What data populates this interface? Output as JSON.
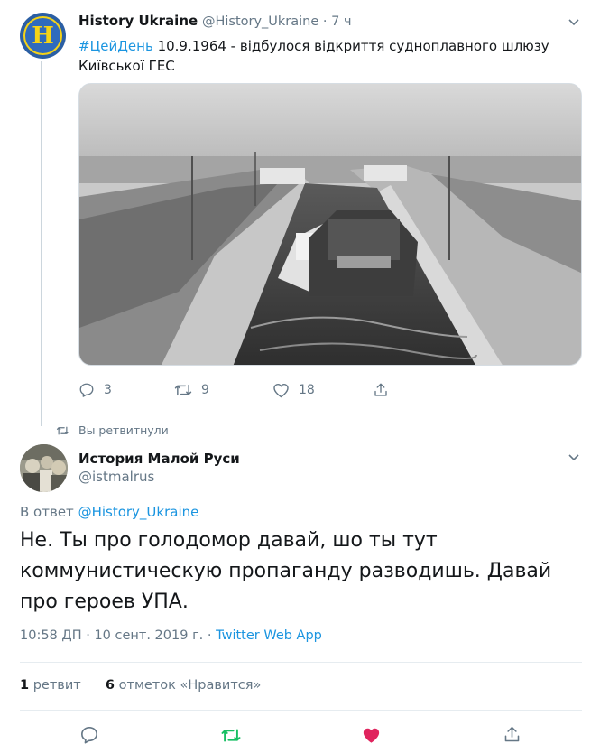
{
  "tweet1": {
    "author_name": "History Ukraine",
    "author_handle": "@History_Ukraine",
    "time_sep": " · ",
    "time": "7 ч",
    "hashtag": "#ЦейДень",
    "text": " 10.9.1964 - відбулося відкриття судноплавного шлюзу Київської ГЕС",
    "replies": "3",
    "retweets": "9",
    "likes": "18"
  },
  "retweet_notice": "Вы ретвитнули",
  "tweet2": {
    "author_name": "История Малой Руси",
    "author_handle": "@istmalrus",
    "reply_prefix": "В ответ ",
    "reply_to": "@History_Ukraine",
    "text": "Не. Ты про голодомор давай, шо ты тут коммунистическую пропаганду разводишь. Давай про героев УПА.",
    "timestamp": "10:58 ДП · 10 сент. 2019 г.",
    "meta_sep": " · ",
    "source": "Twitter Web App",
    "retweet_count": "1",
    "retweet_label": " ретвит",
    "like_count": "6",
    "like_label": " отметок «Нравится»"
  },
  "colors": {
    "link": "#1b95e0",
    "secondary": "#657786",
    "retweet_active": "#17bf63",
    "like_active": "#e0245e"
  },
  "icons": [
    "reply-icon",
    "retweet-icon",
    "like-icon",
    "share-icon",
    "chevron-down-icon"
  ]
}
